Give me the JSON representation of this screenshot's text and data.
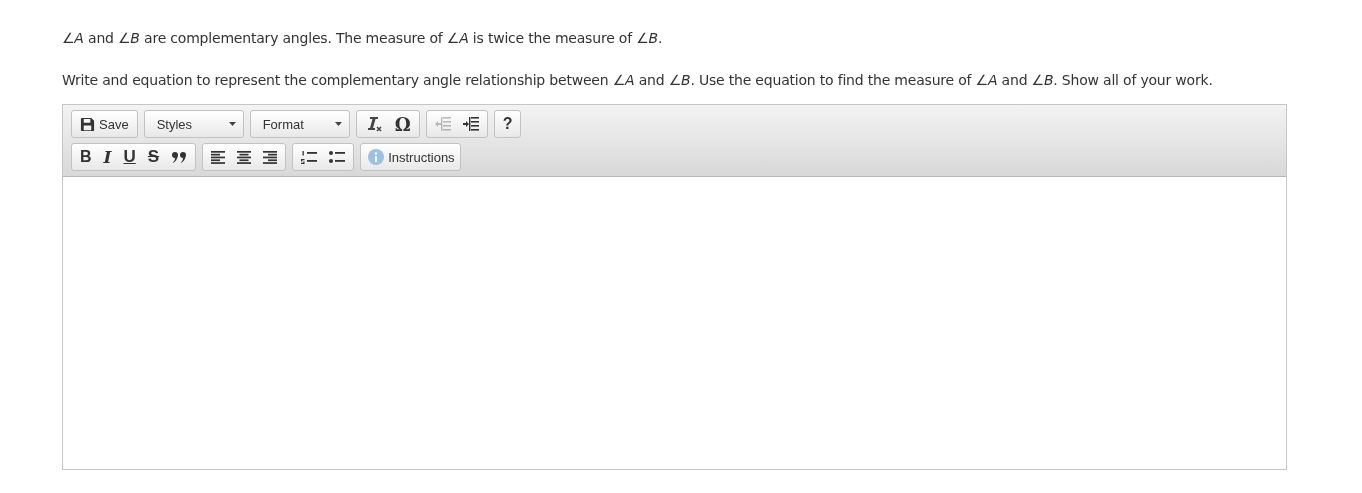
{
  "question": [
    "∠*A* and ∠*B* are complementary angles. The measure of ∠*A* is twice the measure of ∠*B*.",
    "Write and equation to represent the complementary angle relationship between ∠*A* and ∠*B*. Use the equation to find the measure of ∠*A* and ∠*B*. Show all of your work."
  ],
  "editor": {
    "toolbar": [
      [
        [
          {
            "kind": "save",
            "label": "Save",
            "disabled": false
          }
        ],
        [
          {
            "kind": "combo",
            "label": "Styles",
            "disabled": false
          }
        ],
        [
          {
            "kind": "combo",
            "label": "Format",
            "disabled": false
          }
        ],
        [
          {
            "kind": "clear-format",
            "disabled": false
          },
          {
            "kind": "glyph",
            "label": "Ω",
            "disabled": false
          }
        ],
        [
          {
            "kind": "outdent",
            "disabled": true
          },
          {
            "kind": "indent",
            "disabled": false
          }
        ],
        [
          {
            "kind": "glyph-bold",
            "label": "?",
            "disabled": false
          }
        ]
      ],
      [
        [
          {
            "kind": "glyph-bold",
            "label": "B",
            "disabled": false
          },
          {
            "kind": "glyph-italic",
            "label": "I",
            "disabled": false
          },
          {
            "kind": "glyph-underline",
            "label": "U",
            "disabled": false
          },
          {
            "kind": "glyph-strike",
            "label": "S",
            "disabled": false
          },
          {
            "kind": "quote",
            "disabled": false
          }
        ],
        [
          {
            "kind": "align-left",
            "disabled": false
          },
          {
            "kind": "align-center",
            "disabled": false
          },
          {
            "kind": "align-right",
            "disabled": false
          }
        ],
        [
          {
            "kind": "numbered-list",
            "disabled": false
          },
          {
            "kind": "bulleted-list",
            "disabled": false
          }
        ],
        [
          {
            "kind": "info",
            "label": "Instructions",
            "disabled": false
          }
        ]
      ]
    ]
  }
}
